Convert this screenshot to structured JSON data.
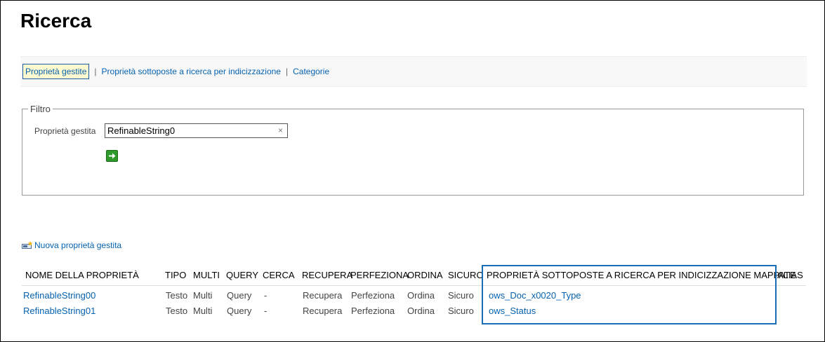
{
  "page": {
    "title": "Ricerca"
  },
  "tabs": [
    {
      "label": "Proprietà gestite",
      "active": true
    },
    {
      "label": "Proprietà sottoposte a ricerca per indicizzazione",
      "active": false
    },
    {
      "label": "Categorie",
      "active": false
    }
  ],
  "tab_separator": "|",
  "filter": {
    "legend": "Filtro",
    "label": "Proprietà gestita",
    "value": "RefinableString0",
    "clear_glyph": "×",
    "go_icon": "arrow-right-icon"
  },
  "new_property": {
    "label": "Nuova proprietà gestita",
    "icon": "new-property-icon"
  },
  "table": {
    "headers": {
      "name": "NOME DELLA PROPRIETÀ",
      "type": "TIPO",
      "multi": "MULTI",
      "query": "QUERY",
      "search": "CERCA",
      "retrieve": "RECUPERA",
      "refine": "PERFEZIONA",
      "sort": "ORDINA",
      "safe": "SICURO",
      "mapped": "PROPRIETÀ SOTTOPOSTE A RICERCA PER INDICIZZAZIONE MAPPATE",
      "alias": "ALIAS"
    },
    "rows": [
      {
        "name": "RefinableString00",
        "type": "Testo",
        "multi": "Multi",
        "query": "Query",
        "search": "-",
        "retrieve": "Recupera",
        "refine": "Perfeziona",
        "sort": "Ordina",
        "safe": "Sicuro",
        "mapped": "ows_Doc_x0020_Type",
        "alias": ""
      },
      {
        "name": "RefinableString01",
        "type": "Testo",
        "multi": "Multi",
        "query": "Query",
        "search": "-",
        "retrieve": "Recupera",
        "refine": "Perfeziona",
        "sort": "Ordina",
        "safe": "Sicuro",
        "mapped": "ows_Status",
        "alias": ""
      }
    ]
  },
  "colors": {
    "link": "#0562b0",
    "highlight": "#1a6eb6",
    "active_tab_bg": "#fffacf"
  }
}
